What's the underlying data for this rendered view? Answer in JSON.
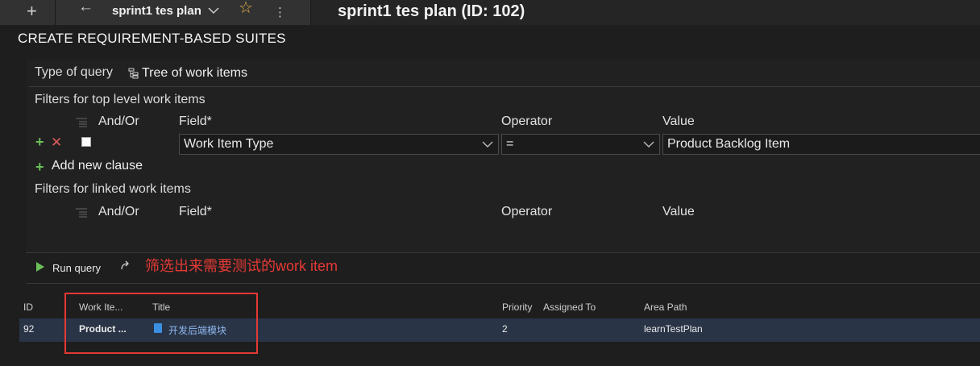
{
  "topbar": {
    "new_tab_icon": "plus-icon",
    "back_icon": "arrow-left-icon",
    "tab_name": "sprint1 tes plan",
    "chevron_icon": "chevron-down-icon",
    "favorite_icon": "star-icon",
    "more_icon": "ellipsis-vertical-icon",
    "page_title": "sprint1 tes plan (ID: 102)"
  },
  "section_title": "CREATE REQUIREMENT-BASED SUITES",
  "query": {
    "type_label": "Type of query",
    "type_icon": "tree-icon",
    "type_value": "Tree of work items"
  },
  "top_filters": {
    "title": "Filters for top level work items",
    "columns": {
      "andor": "And/Or",
      "field": "Field*",
      "operator": "Operator",
      "value": "Value"
    },
    "clause": {
      "field": "Work Item Type",
      "operator": "=",
      "value": "Product Backlog Item"
    },
    "add_clause_label": "Add new clause"
  },
  "linked_filters": {
    "title": "Filters for linked work items",
    "columns": {
      "andor": "And/Or",
      "field": "Field*",
      "operator": "Operator",
      "value": "Value"
    }
  },
  "run": {
    "run_label": "Run query",
    "annotation": "筛选出来需要测试的work item"
  },
  "grid": {
    "headers": {
      "id": "ID",
      "work_item": "Work Ite...",
      "title": "Title",
      "priority": "Priority",
      "assigned": "Assigned To",
      "area": "Area Path"
    },
    "rows": [
      {
        "id": "92",
        "work_item": "Product ...",
        "title": "开发后端模块",
        "priority": "2",
        "assigned": "",
        "area": "learnTestPlan"
      }
    ]
  },
  "colors": {
    "accent_green": "#6bbf59",
    "annotation_red": "#e53935",
    "selected_row": "#2a3447",
    "link_blue": "#8fb8ee"
  }
}
